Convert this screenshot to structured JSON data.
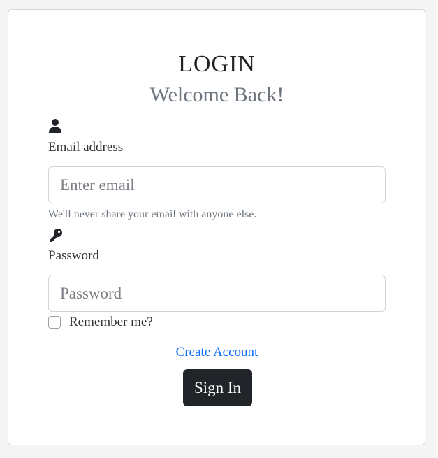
{
  "card": {
    "title": "LOGIN",
    "subtitle": "Welcome Back!"
  },
  "email": {
    "icon": "user-icon",
    "label": "Email address",
    "placeholder": "Enter email",
    "value": "",
    "help": "We'll never share your email with anyone else."
  },
  "password": {
    "icon": "key-icon",
    "label": "Password",
    "placeholder": "Password",
    "value": ""
  },
  "remember": {
    "label": "Remember me?",
    "checked": false
  },
  "create_account": {
    "label": "Create Account"
  },
  "sign_in": {
    "label": "Sign In"
  },
  "colors": {
    "link": "#0d6efd",
    "button_bg": "#212529",
    "muted_text": "#6c757d"
  }
}
